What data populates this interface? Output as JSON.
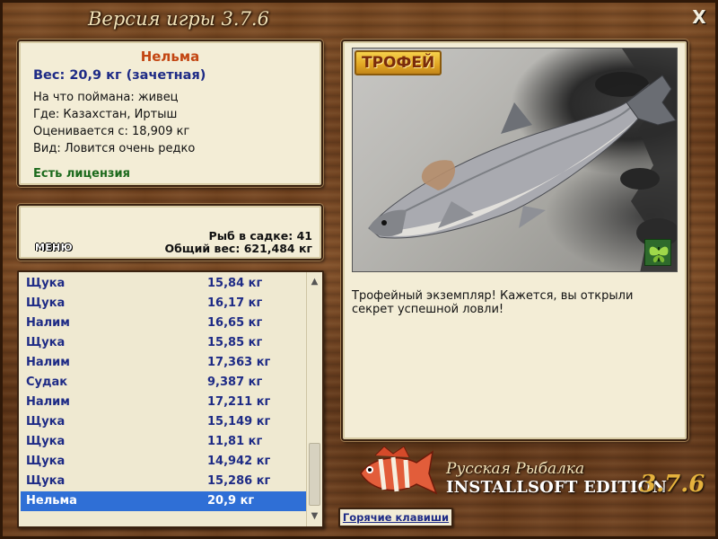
{
  "window": {
    "title": "Версия игры 3.7.6",
    "close_label": "X"
  },
  "fish_info": {
    "name": "Нельма",
    "weight": "Вес: 20,9 кг (зачетная)",
    "bait": "На что поймана: живец",
    "location": "Где: Казахстан, Иртыш",
    "threshold": "Оценивается с: 18,909 кг",
    "rarity": "Вид: Ловится очень редко",
    "license": "Есть лицензия"
  },
  "stats": {
    "menu_label": "МЕНЮ",
    "fish_in_keepnet": "Рыб в садке: 41",
    "total_weight": "Общий вес: 621,484 кг"
  },
  "catch_list": [
    {
      "name": "Щука",
      "weight": "15,84 кг"
    },
    {
      "name": "Щука",
      "weight": "16,17 кг"
    },
    {
      "name": "Налим",
      "weight": "16,65 кг"
    },
    {
      "name": "Щука",
      "weight": "15,85 кг"
    },
    {
      "name": "Налим",
      "weight": "17,363 кг"
    },
    {
      "name": "Судак",
      "weight": "9,387 кг"
    },
    {
      "name": "Налим",
      "weight": "17,211 кг"
    },
    {
      "name": "Щука",
      "weight": "15,149 кг"
    },
    {
      "name": "Щука",
      "weight": "11,81 кг"
    },
    {
      "name": "Щука",
      "weight": "14,942 кг"
    },
    {
      "name": "Щука",
      "weight": "15,286 кг"
    },
    {
      "name": "Нельма",
      "weight": "20,9 кг"
    }
  ],
  "selected_index": 11,
  "trophy": {
    "badge": "ТРОФЕЙ",
    "message": "Трофейный экземпляр! Кажется, вы открыли секрет успешной ловли!"
  },
  "logo": {
    "line1": "Русская Рыбалка",
    "line2": "INSTALLSOFT EDITION",
    "version": "3.7.6"
  },
  "hotkeys_label": "Горячие клавиши",
  "colors": {
    "selected_row": "#2f6fd6",
    "fish_name": "#c34612",
    "list_text": "#1e2b86",
    "license": "#1c6a1c"
  }
}
